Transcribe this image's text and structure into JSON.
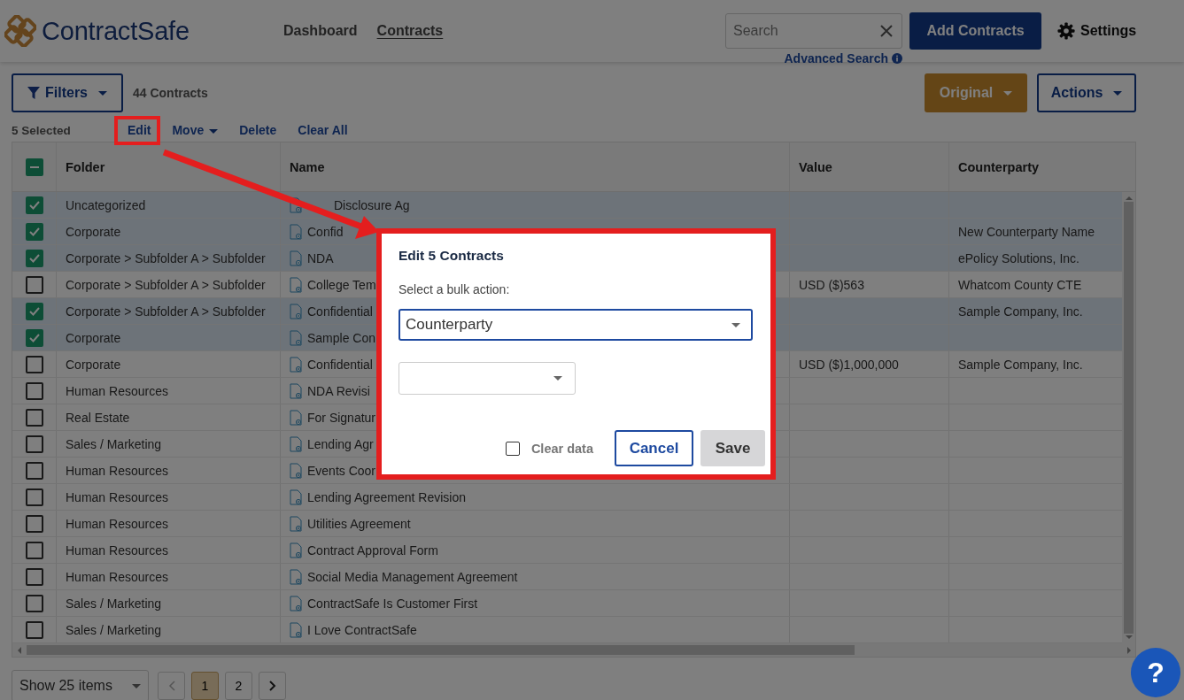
{
  "app": {
    "logo": "ContractSafe"
  },
  "nav": [
    {
      "label": "Dashboard",
      "selected": false
    },
    {
      "label": "Contracts",
      "selected": true
    }
  ],
  "search": {
    "placeholder": "Search",
    "advanced_link": "Advanced Search"
  },
  "header_buttons": {
    "add": "Add Contracts",
    "settings": "Settings"
  },
  "toolbar": {
    "filters": "Filters",
    "count": "44 Contracts",
    "view": "Original",
    "actions": "Actions"
  },
  "selection": {
    "count": "5 Selected",
    "actions": [
      {
        "label": "Edit",
        "dropdown": false
      },
      {
        "label": "Move",
        "dropdown": true
      },
      {
        "label": "Delete",
        "dropdown": false
      },
      {
        "label": "Clear All",
        "dropdown": false
      }
    ]
  },
  "table": {
    "select_all_partial": true,
    "columns": [
      "Folder",
      "Name",
      "Value",
      "Counterparty"
    ],
    "rows": [
      {
        "checked": true,
        "folder": "Uncategorized",
        "name": "Disclosure Ag",
        "value": "",
        "counterparty": ""
      },
      {
        "checked": true,
        "folder": "Corporate",
        "name": "Confid",
        "value": "",
        "counterparty": "New Counterparty Name"
      },
      {
        "checked": true,
        "folder": "Corporate > Subfolder A > Subfolder",
        "name": "NDA",
        "value": "",
        "counterparty": "ePolicy Solutions, Inc."
      },
      {
        "checked": false,
        "folder": "Corporate > Subfolder A > Subfolder",
        "name": "College Tem",
        "value": "USD ($)563",
        "counterparty": "Whatcom County CTE"
      },
      {
        "checked": true,
        "folder": "Corporate > Subfolder A > Subfolder",
        "name": "Confidential",
        "value": "",
        "counterparty": "Sample Company, Inc."
      },
      {
        "checked": true,
        "folder": "Corporate",
        "name": "Sample Con",
        "value": "",
        "counterparty": ""
      },
      {
        "checked": false,
        "folder": "Corporate",
        "name": "Confidential",
        "value": "USD ($)1,000,000",
        "counterparty": "Sample Company, Inc."
      },
      {
        "checked": false,
        "folder": "Human Resources",
        "name": "NDA Revisi",
        "value": "",
        "counterparty": ""
      },
      {
        "checked": false,
        "folder": "Real Estate",
        "name": "For Signatur",
        "value": "",
        "counterparty": ""
      },
      {
        "checked": false,
        "folder": "Sales / Marketing",
        "name": "Lending Agr",
        "value": "",
        "counterparty": ""
      },
      {
        "checked": false,
        "folder": "Human Resources",
        "name": "Events Coor",
        "value": "",
        "counterparty": ""
      },
      {
        "checked": false,
        "folder": "Human Resources",
        "name": "Lending Agreement Revision",
        "value": "",
        "counterparty": ""
      },
      {
        "checked": false,
        "folder": "Human Resources",
        "name": "Utilities Agreement",
        "value": "",
        "counterparty": ""
      },
      {
        "checked": false,
        "folder": "Human Resources",
        "name": "Contract Approval Form",
        "value": "",
        "counterparty": ""
      },
      {
        "checked": false,
        "folder": "Human Resources",
        "name": "Social Media Management Agreement",
        "value": "",
        "counterparty": ""
      },
      {
        "checked": false,
        "folder": "Sales / Marketing",
        "name": "ContractSafe Is Customer First",
        "value": "",
        "counterparty": ""
      },
      {
        "checked": false,
        "folder": "Sales / Marketing",
        "name": "I Love ContractSafe",
        "value": "",
        "counterparty": ""
      }
    ]
  },
  "pagination": {
    "page_size": "Show 25 items",
    "pages": [
      {
        "label": "1",
        "selected": true
      },
      {
        "label": "2",
        "selected": false
      }
    ]
  },
  "help": "?",
  "dialog": {
    "title": "Edit 5 Contracts",
    "prompt": "Select a bulk action:",
    "action": "Counterparty",
    "clear_data": {
      "label": "Clear data",
      "checked": false
    },
    "buttons": [
      {
        "label": "Cancel",
        "disabled": false
      },
      {
        "label": "Save",
        "disabled": true
      }
    ]
  }
}
